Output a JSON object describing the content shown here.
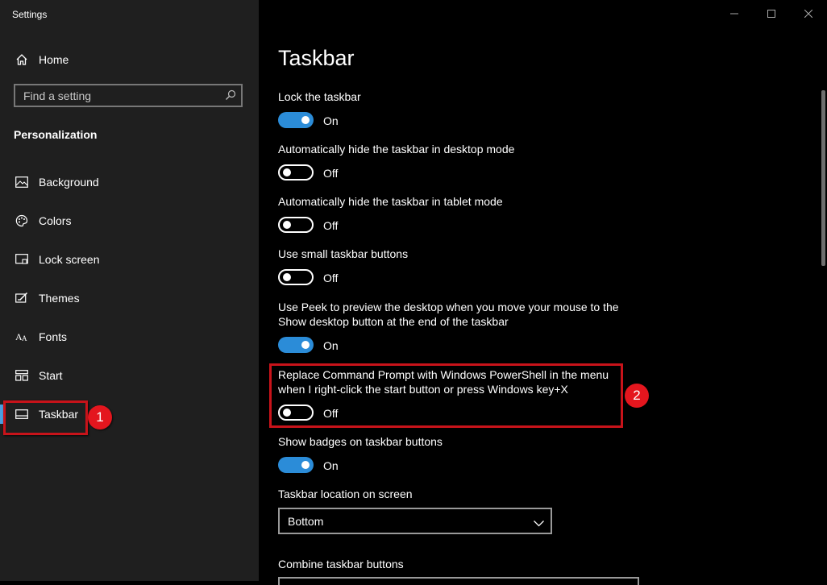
{
  "window": {
    "title": "Settings"
  },
  "sidebar": {
    "home_label": "Home",
    "search_placeholder": "Find a setting",
    "section_title": "Personalization",
    "items": [
      {
        "label": "Background",
        "icon": "picture-icon"
      },
      {
        "label": "Colors",
        "icon": "palette-icon"
      },
      {
        "label": "Lock screen",
        "icon": "lock-screen-icon"
      },
      {
        "label": "Themes",
        "icon": "themes-icon"
      },
      {
        "label": "Fonts",
        "icon": "fonts-icon"
      },
      {
        "label": "Start",
        "icon": "start-icon"
      },
      {
        "label": "Taskbar",
        "icon": "taskbar-icon",
        "selected": true
      }
    ]
  },
  "annotations": {
    "badge1": "1",
    "badge2": "2"
  },
  "main": {
    "title": "Taskbar",
    "settings": [
      {
        "label": "Lock the taskbar",
        "state": "On"
      },
      {
        "label": "Automatically hide the taskbar in desktop mode",
        "state": "Off"
      },
      {
        "label": "Automatically hide the taskbar in tablet mode",
        "state": "Off"
      },
      {
        "label": "Use small taskbar buttons",
        "state": "Off"
      },
      {
        "label_line1": "Use Peek to preview the desktop when you move your mouse to the",
        "label_line2": "Show desktop button at the end of the taskbar",
        "state": "On"
      },
      {
        "label_line1": "Replace Command Prompt with Windows PowerShell in the menu",
        "label_line2": "when I right-click the start button or press Windows key+X",
        "state": "Off"
      },
      {
        "label": "Show badges on taskbar buttons",
        "state": "On"
      }
    ],
    "location": {
      "label": "Taskbar location on screen",
      "value": "Bottom"
    },
    "combine": {
      "label": "Combine taskbar buttons"
    }
  },
  "colors": {
    "accent": "#2b8cd8",
    "highlight": "#c8131a",
    "badge": "#e4161e",
    "sidebar_bg": "#1f1f1f"
  }
}
